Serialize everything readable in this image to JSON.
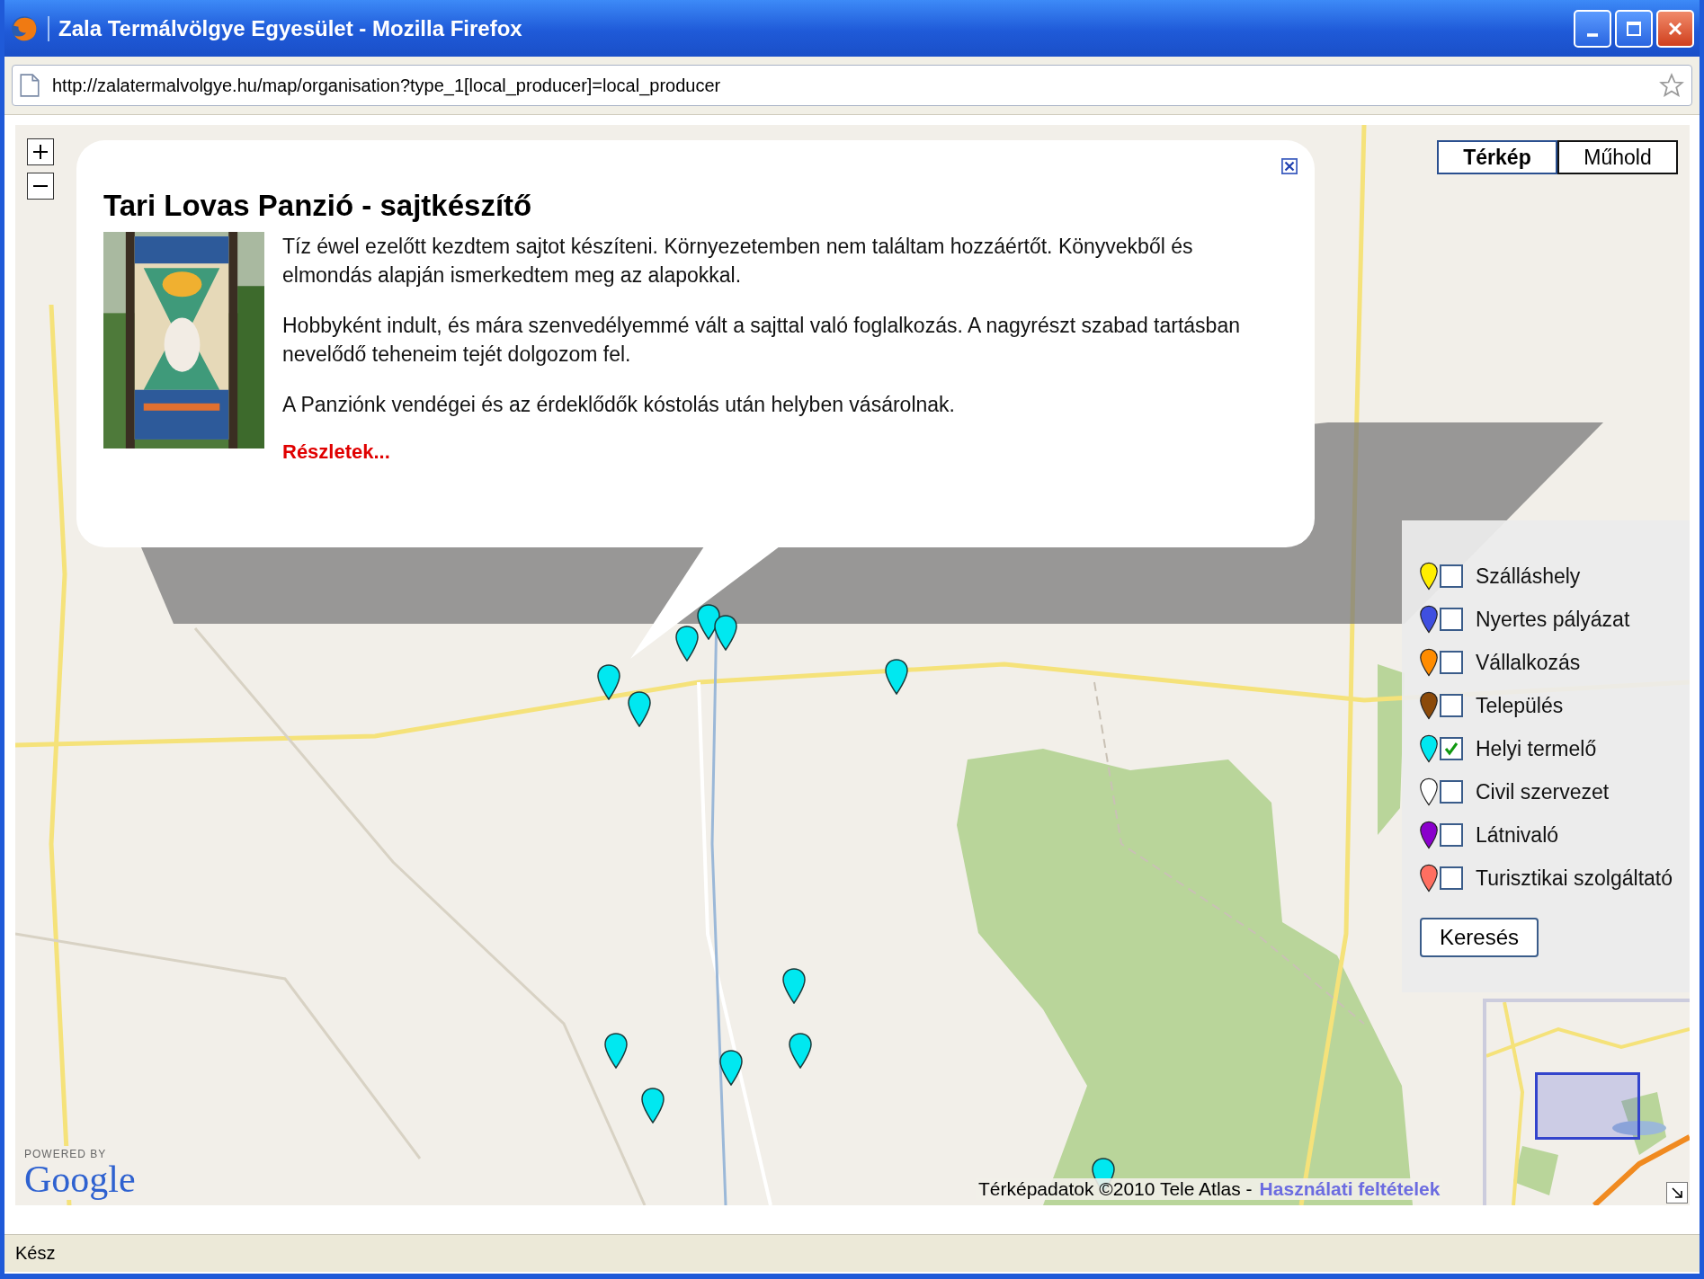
{
  "window": {
    "title": "Zala Termálvölgye Egyesület - Mozilla Firefox"
  },
  "address_bar": {
    "url": "http://zalatermalvolgye.hu/map/organisation?type_1[local_producer]=local_producer"
  },
  "map": {
    "map_types": [
      {
        "label": "Térkép",
        "selected": true
      },
      {
        "label": "Műhold",
        "selected": false
      }
    ],
    "popup": {
      "title": "Tari Lovas Panzió - sajtkészítő",
      "paragraphs": [
        "Tíz éwel ezelőtt kezdtem sajtot készíteni. Környezetemben nem találtam hozzáértőt. Könyvekből és elmondás alapján ismerkedtem meg az alapokkal.",
        "Hobbyként indult, és mára szenvedélyemmé vált a sajttal való foglalkozás. A nagyrészt szabad tartásban nevelődő teheneim tejét dolgozom fel.",
        "A Panziónk vendégei és az érdeklődők kóstolás után helyben vásárolnak."
      ],
      "link": "Részletek..."
    },
    "legend": [
      {
        "label": "Szálláshely",
        "color": "#ffee00",
        "checked": false
      },
      {
        "label": "Nyertes pályázat",
        "color": "#3f4fe0",
        "checked": false
      },
      {
        "label": "Vállalkozás",
        "color": "#ff8c00",
        "checked": false
      },
      {
        "label": "Település",
        "color": "#8b4a0a",
        "checked": false
      },
      {
        "label": "Helyi termelő",
        "color": "#00e8f0",
        "checked": true
      },
      {
        "label": "Civil szervezet",
        "color": "#ffffff",
        "checked": false
      },
      {
        "label": "Látnivaló",
        "color": "#8a00cc",
        "checked": false
      },
      {
        "label": "Turisztikai szolgáltató",
        "color": "#ff6f61",
        "checked": false
      }
    ],
    "search_button": "Keresés",
    "attribution": {
      "text": "Térképadatok ©2010 Tele Atlas -",
      "link": "Használati feltételek"
    },
    "logo": {
      "caption": "POWERED BY",
      "name": "Google"
    }
  },
  "status_bar": {
    "text": "Kész"
  }
}
